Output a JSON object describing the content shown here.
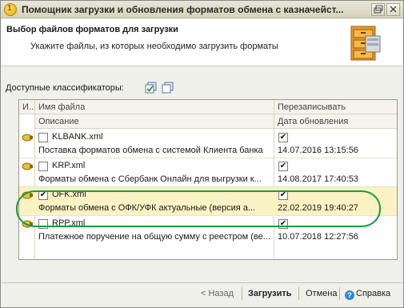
{
  "window": {
    "title": "Помощник загрузки и обновления форматов обмена с казначейст...",
    "icon": "app-1c-icon"
  },
  "header": {
    "title": "Выбор файлов форматов для загрузки",
    "subtitle": "Укажите файлы, из которых необходимо загрузить форматы"
  },
  "classifiers": {
    "label": "Доступные классификаторы:"
  },
  "table": {
    "col_index": "И..",
    "col_filename": "Имя файла",
    "col_rewrite": "Перезаписывать",
    "col_description": "Описание",
    "col_updated": "Дата обновления",
    "rows": [
      {
        "name": "KLBANK.xml",
        "checked": false,
        "rewrite": true,
        "description": "Поставка форматов обмена с системой Клиента банка",
        "updated": "14.07.2016 13:15:56"
      },
      {
        "name": "KRP.xml",
        "checked": false,
        "rewrite": true,
        "description": "Форматы обмена с Сбербанк Онлайн для выгрузки к...",
        "updated": "14.08.2017 17:40:53"
      },
      {
        "name": "OFK.xml",
        "checked": true,
        "rewrite": true,
        "description": "Форматы обмена с ОФК/УФК актуальные (версия а...",
        "updated": "22.02.2019 19:40:27"
      },
      {
        "name": "RPP.xml",
        "checked": false,
        "rewrite": true,
        "description": "Платежное поручение на общую сумму с реестром (ве...",
        "updated": "10.07.2018 12:27:56"
      }
    ]
  },
  "footer": {
    "back": "< Назад",
    "load": "Загрузить",
    "cancel": "Отмена",
    "help": "Справка"
  },
  "colors": {
    "highlight_outline": "#1e9a3c",
    "selected_row": "#fbf2c4"
  }
}
